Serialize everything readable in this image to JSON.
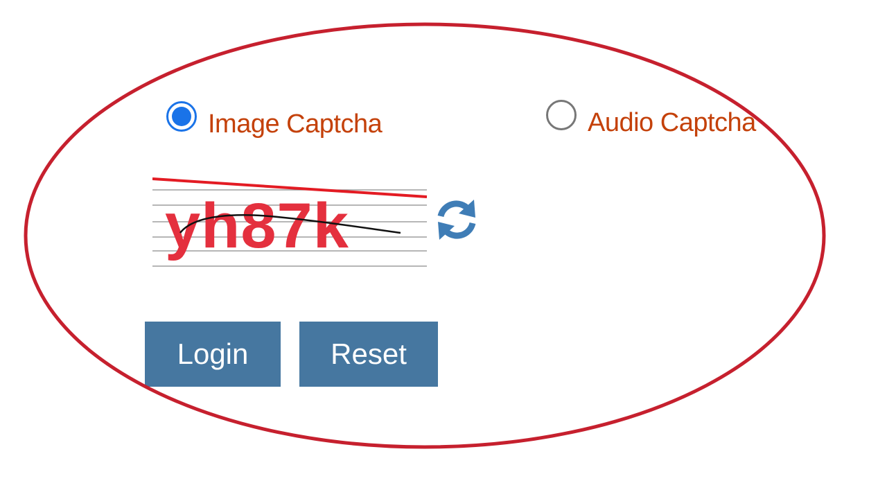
{
  "captcha_options": {
    "image": {
      "label": "Image Captcha",
      "selected": true
    },
    "audio": {
      "label": "Audio Captcha",
      "selected": false
    }
  },
  "captcha": {
    "text": "yh87k",
    "text_color": "#e4303e",
    "strike_color": "#e31b23"
  },
  "buttons": {
    "login_label": "Login",
    "reset_label": "Reset",
    "color": "#4677a0"
  },
  "icons": {
    "refresh": "refresh-icon"
  },
  "annotation": {
    "ellipse_color": "#c6202e"
  }
}
